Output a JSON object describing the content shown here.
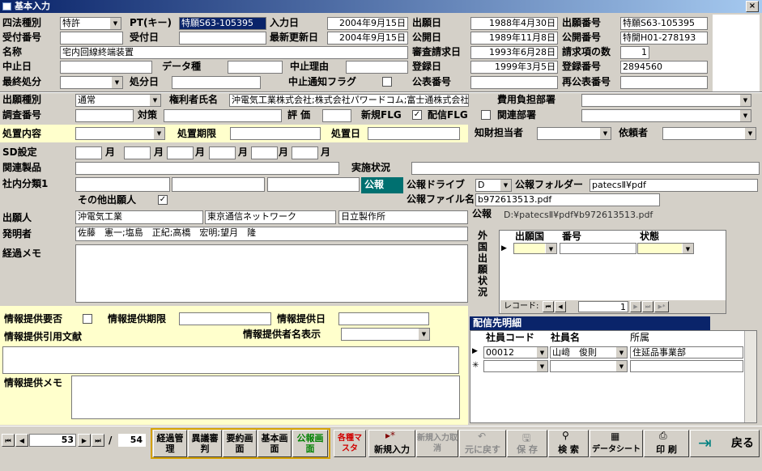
{
  "window": {
    "title": "基本入力",
    "close": "×"
  },
  "r1": {
    "l4": "四法種別",
    "v4": "特許",
    "pt": "PT(キー)",
    "ptv": "特願S63-105395",
    "in": "入力日",
    "inv": "2004年9月15日",
    "ap": "出願日",
    "apv": "1988年4月30日",
    "an": "出願番号",
    "anv": "特願S63-105395"
  },
  "r2": {
    "uk": "受付番号",
    "ud": "受付日",
    "up": "最新更新日",
    "upv": "2004年9月15日",
    "pb": "公開日",
    "pbv": "1989年11月8日",
    "pn": "公開番号",
    "pnv": "特開H01-278193"
  },
  "r3": {
    "nm": "名称",
    "nmv": "宅内回線終端装置",
    "sr": "審査請求日",
    "srv": "1993年6月28日",
    "cl": "請求項の数",
    "clv": "1"
  },
  "r4": {
    "cd": "中止日",
    "dt": "データ種",
    "rs": "中止理由",
    "rg": "登録日",
    "rgv": "1999年3月5日",
    "rn": "登録番号",
    "rnv": "2894560"
  },
  "r5": {
    "fd": "最終処分",
    "fdd": "処分日",
    "nf": "中止通知フラグ",
    "kn": "公表番号",
    "rk": "再公表番号"
  },
  "s2": {
    "ak": "出願種別",
    "akv": "通常",
    "rh": "権利者氏名",
    "rhv": "沖電気工業株式会社;株式会社パワードコム;富士通株式会社;日",
    "cost": "費用負担部署",
    "sn": "調査番号",
    "tg": "対策",
    "ev": "評 価",
    "nw": "新規FLG",
    "hf": "配信FLG",
    "rd": "関連部署"
  },
  "s3": {
    "pc": "処置内容",
    "pl": "処置期限",
    "pd": "処置日",
    "ip": "知財担当者",
    "rq": "依頼者"
  },
  "s4": {
    "sd": "SD設定",
    "m": "月",
    "rp": "関連製品",
    "st": "実施状況",
    "ic": "社内分類1",
    "pub": "公報",
    "other": "その他出願人",
    "drv": "公報ドライブ",
    "drvv": "D",
    "fol": "公報フォルダー",
    "folv": "patecsⅡ¥pdf",
    "fil": "公報ファイル名",
    "filv": "b972613513.pdf",
    "pub2": "公報",
    "pathv": "D:¥patecsⅡ¥pdf¥b972613513.pdf"
  },
  "s5": {
    "ap": "出願人",
    "ap1": "沖電気工業",
    "ap2": "東京通信ネットワーク",
    "ap3": "日立製作所",
    "inv": "発明者",
    "invv": "佐藤　憲一;塩島　正紀;高橋　宏明;望月　隆",
    "memo": "経過メモ"
  },
  "foreign": {
    "label": "外国出願状況",
    "h1": "出願国",
    "h2": "番号",
    "h3": "状態",
    "rec": "レコード:",
    "recv": "1"
  },
  "info": {
    "req": "情報提供要否",
    "per": "情報提供期限",
    "day": "情報提供日",
    "cite": "情報提供引用文献",
    "name": "情報提供者名表示",
    "memo": "情報提供メモ"
  },
  "dist": {
    "title": "配信先明細",
    "h1": "社員コード",
    "h2": "社員名",
    "h3": "所属",
    "c1": "00012",
    "n1": "山﨑　俊則",
    "d1": "住延品事業部"
  },
  "nav": {
    "cur": "53",
    "sep": "/",
    "total": "54"
  },
  "buttons": {
    "b1": "経過管理",
    "b2": "異議審判",
    "b3": "要約画面",
    "b4": "基本画面",
    "b5": "公報画面",
    "b6": "各種マスタ",
    "b7": "新規入力",
    "b8": "新規入力取消",
    "b9": "元に戻す",
    "b10": "保 存",
    "b11": "検 索",
    "b12": "データシート",
    "b13": "印 刷",
    "b14": "戻る"
  },
  "colors": {
    "yellow": "#ffffcc",
    "navy": "#0a246a",
    "teal": "#007070"
  }
}
